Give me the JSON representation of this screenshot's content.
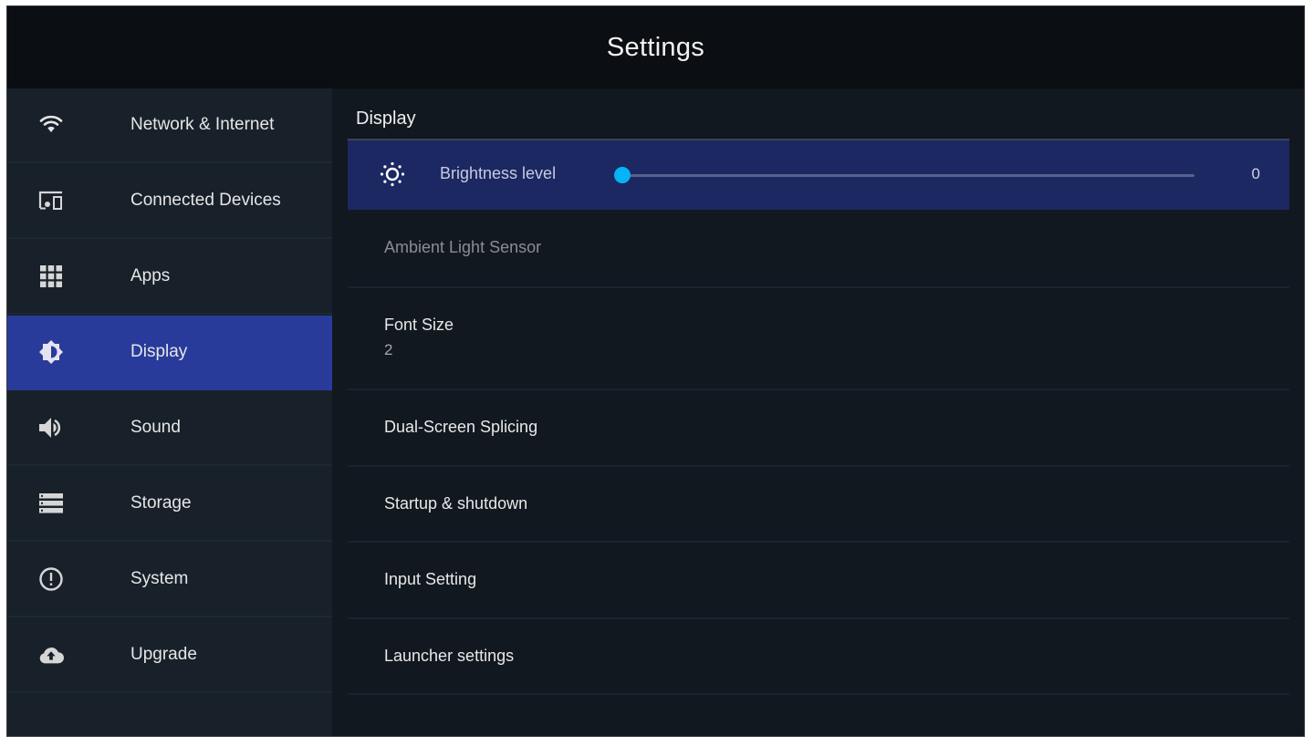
{
  "header": {
    "title": "Settings"
  },
  "sidebar": {
    "items": [
      {
        "label": "Network & Internet",
        "icon": "wifi-icon",
        "active": false
      },
      {
        "label": "Connected Devices",
        "icon": "connected-devices-icon",
        "active": false
      },
      {
        "label": "Apps",
        "icon": "apps-grid-icon",
        "active": false
      },
      {
        "label": "Display",
        "icon": "brightness-icon",
        "active": true
      },
      {
        "label": "Sound",
        "icon": "volume-icon",
        "active": false
      },
      {
        "label": "Storage",
        "icon": "storage-icon",
        "active": false
      },
      {
        "label": "System",
        "icon": "info-alert-icon",
        "active": false
      },
      {
        "label": "Upgrade",
        "icon": "cloud-upload-icon",
        "active": false
      }
    ]
  },
  "main": {
    "section_title": "Display",
    "brightness": {
      "label": "Brightness level",
      "value": "0",
      "level_fraction": 0,
      "icon": "sun-icon"
    },
    "items": [
      {
        "label": "Ambient Light Sensor",
        "disabled": true
      },
      {
        "label": "Font Size",
        "value": "2"
      },
      {
        "label": "Dual-Screen Splicing"
      },
      {
        "label": "Startup & shutdown"
      },
      {
        "label": "Input Setting"
      },
      {
        "label": "Launcher settings"
      }
    ]
  },
  "colors": {
    "accent_active": "#293b9a",
    "focused_row": "#1c2862",
    "slider_thumb": "#05b4f6"
  }
}
